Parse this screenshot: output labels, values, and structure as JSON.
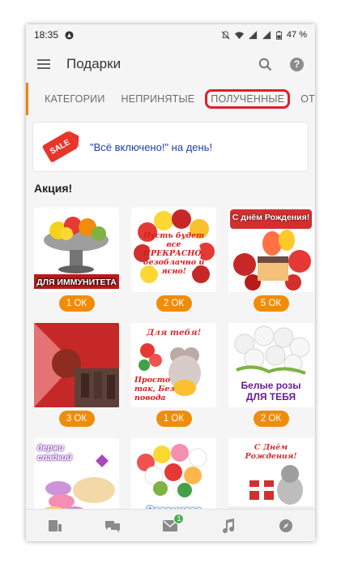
{
  "status_bar": {
    "time": "18:35",
    "battery": "47 %"
  },
  "app_bar": {
    "title": "Подарки"
  },
  "tabs": [
    {
      "label": "КАТЕГОРИИ"
    },
    {
      "label": "НЕПРИНЯТЫЕ"
    },
    {
      "label": "ПОЛУЧЕННЫЕ"
    },
    {
      "label": "ОТПРА"
    }
  ],
  "promo": {
    "tag": "SALE",
    "text": "\"Всё включено!\" на день!"
  },
  "section": {
    "title": "Акция!"
  },
  "gifts": [
    {
      "top": "",
      "caption": "ДЛЯ ИММУНИТЕТА",
      "price": "1 ОК",
      "icon": "fruit-bowl-icon"
    },
    {
      "top": "",
      "caption": "Пусть будет все ПРЕКРАСНО, безоблачно и ясно!",
      "price": "2 ОК",
      "icon": "rose-bouquet-icon"
    },
    {
      "top": "С днём Рождения!",
      "caption": "",
      "price": "5 ОК",
      "icon": "birthday-cake-icon"
    },
    {
      "top": "",
      "caption": "",
      "price": "3 ОК",
      "icon": "army-flag-icon"
    },
    {
      "top": "Для тебя!",
      "caption": "Просто так, Без повода",
      "price": "1 ОК",
      "icon": "mouse-flowers-icon"
    },
    {
      "top": "",
      "caption": "Белые розы ДЛЯ ТЕБЯ",
      "price": "2 ОК",
      "icon": "white-roses-icon"
    },
    {
      "top": "держи сладкий",
      "caption": "",
      "price": "",
      "icon": "macarons-icon"
    },
    {
      "top": "",
      "caption": "Весеннего",
      "price": "",
      "icon": "spring-flowers-icon"
    },
    {
      "top": "С Днём Рождения!",
      "caption": "",
      "price": "",
      "icon": "kitten-gift-icon"
    }
  ],
  "bottom_nav": {
    "messages_badge": "1"
  },
  "colors": {
    "accent": "#f08c0a",
    "highlight": "#e0202a",
    "promo_text": "#1d3fae",
    "sale": "#e8342a",
    "badge": "#4caf50"
  }
}
